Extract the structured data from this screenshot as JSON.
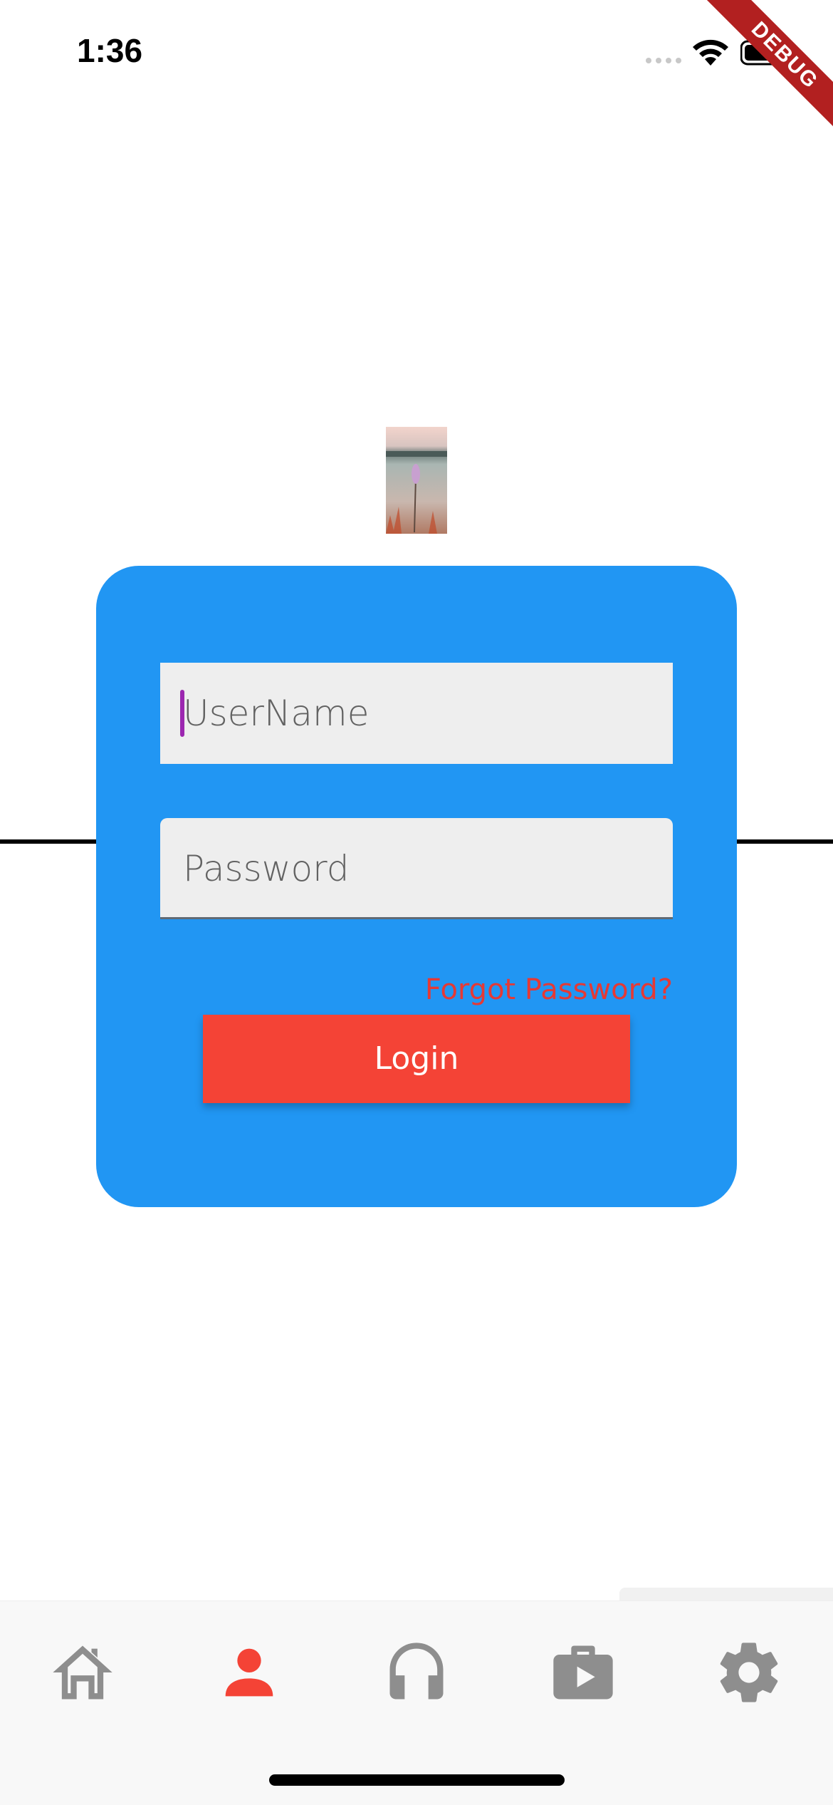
{
  "status_bar": {
    "time": "1:36"
  },
  "debug_banner": {
    "label": "DEBUG"
  },
  "login_form": {
    "username_placeholder": "UserName",
    "password_placeholder": "Password",
    "forgot_password_label": "Forgot Password?",
    "login_label": "Login"
  },
  "bottom_nav": {
    "items": [
      {
        "icon": "home-icon",
        "active": false
      },
      {
        "icon": "person-icon",
        "active": true
      },
      {
        "icon": "headphones-icon",
        "active": false
      },
      {
        "icon": "work-icon",
        "active": false
      },
      {
        "icon": "settings-icon",
        "active": false
      }
    ]
  },
  "colors": {
    "card": "#2196f3",
    "login_button": "#f44336",
    "forgot_link": "#e53935",
    "nav_active": "#f44336",
    "nav_inactive": "#8e8e8e",
    "cursor": "#9c27b0",
    "debug_banner": "#b22020"
  }
}
